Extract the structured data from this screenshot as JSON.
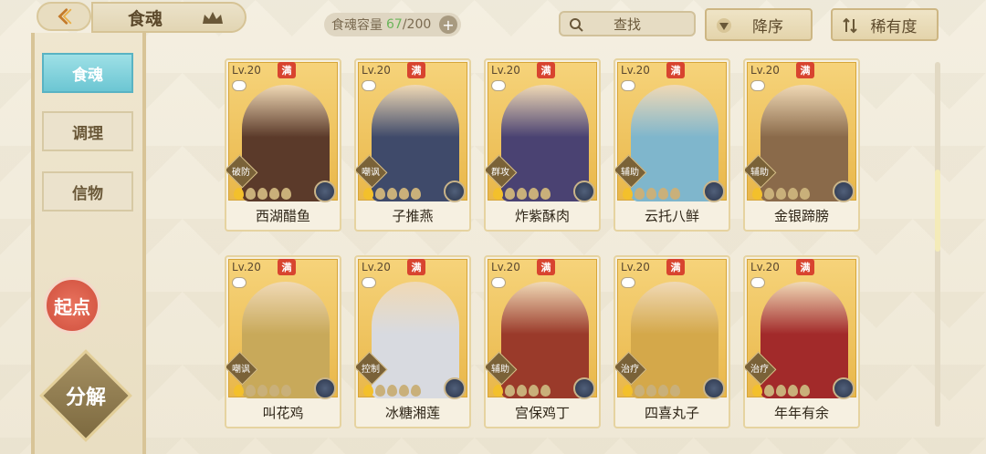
{
  "header": {
    "title": "食魂",
    "capacity_label": "食魂容量",
    "capacity_current": "67",
    "capacity_total": "/200",
    "capacity_add": "+",
    "search_label": "查找",
    "sort_order_label": "降序",
    "sort_rarity_label": "稀有度"
  },
  "sidebar": {
    "items": [
      {
        "label": "食魂",
        "active": true
      },
      {
        "label": "调理",
        "active": false
      },
      {
        "label": "信物",
        "active": false
      }
    ],
    "qidian_label": "起点",
    "fenjie_label": "分解"
  },
  "cards": [
    {
      "level": "Lv.20",
      "full": "满",
      "role": "破防",
      "name": "西湖醋鱼",
      "lit": 1,
      "figure_color": "#5b3a2a"
    },
    {
      "level": "Lv.20",
      "full": "满",
      "role": "嘲讽",
      "name": "子推燕",
      "lit": 1,
      "figure_color": "#3f4a6a"
    },
    {
      "level": "Lv.20",
      "full": "满",
      "role": "群攻",
      "name": "炸紫酥肉",
      "lit": 1,
      "figure_color": "#4a4272"
    },
    {
      "level": "Lv.20",
      "full": "满",
      "role": "辅助",
      "name": "云托八鲜",
      "lit": 1,
      "figure_color": "#7fb6cc"
    },
    {
      "level": "Lv.20",
      "full": "满",
      "role": "辅助",
      "name": "金银蹄膀",
      "lit": 1,
      "figure_color": "#8a6a4a"
    },
    {
      "level": "Lv.20",
      "full": "满",
      "role": "嘲讽",
      "name": "叫花鸡",
      "lit": 1,
      "figure_color": "#c8a95a"
    },
    {
      "level": "Lv.20",
      "full": "满",
      "role": "控制",
      "name": "冰糖湘莲",
      "lit": 1,
      "figure_color": "#d8dae0"
    },
    {
      "level": "Lv.20",
      "full": "满",
      "role": "辅助",
      "name": "宫保鸡丁",
      "lit": 1,
      "figure_color": "#9a3a2a"
    },
    {
      "level": "Lv.20",
      "full": "满",
      "role": "治疗",
      "name": "四喜丸子",
      "lit": 1,
      "figure_color": "#d4a84a"
    },
    {
      "level": "Lv.20",
      "full": "满",
      "role": "治疗",
      "name": "年年有余",
      "lit": 1,
      "figure_color": "#a22a2a"
    }
  ]
}
